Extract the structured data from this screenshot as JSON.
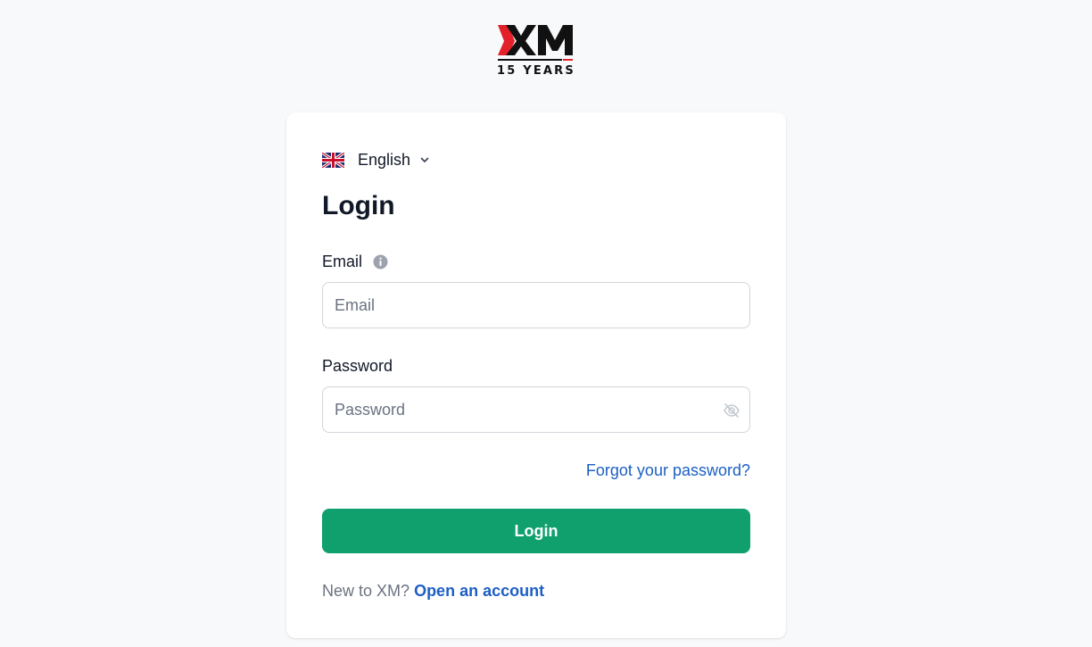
{
  "logo": {
    "wordmark": "XM",
    "tagline": "15 YEARS",
    "colors": {
      "primary": "#111111",
      "accent": "#e4212a"
    }
  },
  "language": {
    "selected": "English",
    "flag_icon": "uk-flag-icon",
    "chevron_icon": "chevron-down-icon"
  },
  "form": {
    "title": "Login",
    "email": {
      "label": "Email",
      "placeholder": "Email",
      "value": "",
      "info_icon": "info-icon"
    },
    "password": {
      "label": "Password",
      "placeholder": "Password",
      "value": "",
      "toggle_icon": "eye-off-icon"
    },
    "forgot_link": "Forgot your password?",
    "submit_label": "Login",
    "signup_prompt": "New to XM?",
    "signup_link": "Open an account"
  },
  "colors": {
    "page_background": "#f8f9fb",
    "card_background": "#ffffff",
    "button": "#0fa06e",
    "link": "#1d5fc4",
    "muted_text": "#6b7280"
  }
}
